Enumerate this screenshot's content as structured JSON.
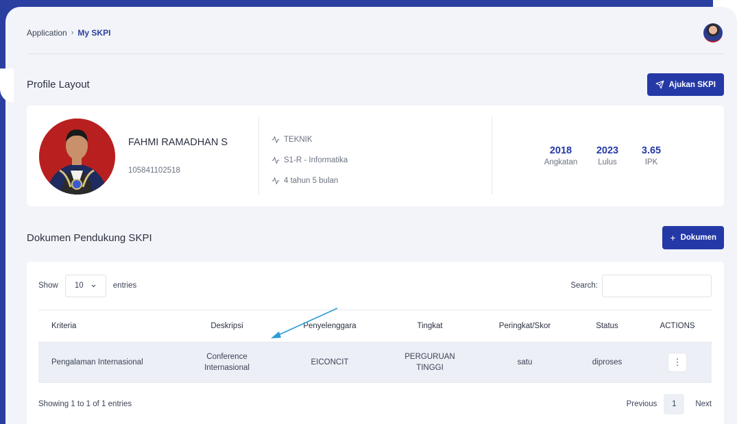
{
  "breadcrumb": {
    "root": "Application",
    "separator": "›",
    "current": "My SKPI"
  },
  "profile_section": {
    "title": "Profile Layout",
    "submit_label": "Ajukan SKPI"
  },
  "profile": {
    "name": "FAHMI RAMADHAN S",
    "nim": "105841102518",
    "info": [
      "TEKNIK",
      "S1-R - Informatika",
      "4 tahun 5 bulan"
    ],
    "stats": [
      {
        "value": "2018",
        "label": "Angkatan"
      },
      {
        "value": "2023",
        "label": "Lulus"
      },
      {
        "value": "3.65",
        "label": "IPK"
      }
    ]
  },
  "documents_section": {
    "title": "Dokumen Pendukung SKPI",
    "add_label": "Dokumen",
    "add_prefix": "+"
  },
  "table_controls": {
    "show_label": "Show",
    "page_size": "10",
    "entries_label": "entries",
    "search_label": "Search:"
  },
  "table": {
    "headers": [
      "Kriteria",
      "Deskripsi",
      "Penyelenggara",
      "Tingkat",
      "Peringkat/Skor",
      "Status",
      "ACTIONS"
    ],
    "rows": [
      {
        "kriteria": "Pengalaman Internasional",
        "deskripsi_1": "Conference",
        "deskripsi_2": "Internasional",
        "penyelenggara": "EICONCIT",
        "tingkat_1": "PERGURUAN",
        "tingkat_2": "TINGGI",
        "peringkat": "satu",
        "status": "diproses",
        "action": "⋮"
      }
    ]
  },
  "footer": {
    "info": "Showing 1 to 1 of 1 entries",
    "previous": "Previous",
    "page": "1",
    "next": "Next"
  },
  "colors": {
    "primary": "#2438a6",
    "frame": "#2a3fa0",
    "panel": "#f3f4f9",
    "arrow": "#2a9bd8"
  },
  "icons": {
    "send": "send-icon",
    "activity": "activity-icon",
    "chevron": "chevron-down-icon",
    "plus": "plus-icon",
    "more": "more-vertical-icon"
  }
}
